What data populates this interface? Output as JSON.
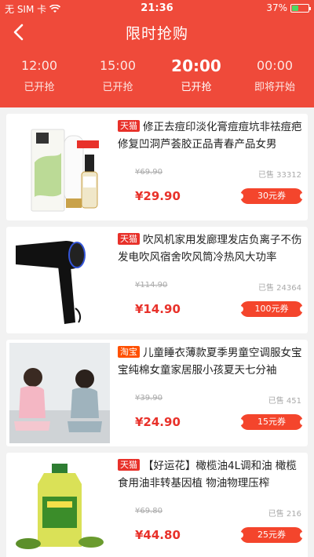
{
  "status": {
    "carrier": "无 SIM 卡",
    "time": "21:36",
    "battery": "37%"
  },
  "nav": {
    "title": "限时抢购"
  },
  "tabs": [
    {
      "time": "12:00",
      "status": "已开抢",
      "active": false
    },
    {
      "time": "15:00",
      "status": "已开抢",
      "active": false
    },
    {
      "time": "20:00",
      "status": "已开抢",
      "active": true
    },
    {
      "time": "00:00",
      "status": "即将开始",
      "active": false
    }
  ],
  "products": [
    {
      "tag": "天猫",
      "title": "修正去痘印淡化膏痘痘坑非祛痘疤修复凹洞芦荟胶正品青春产品女男",
      "orig_price": "¥69.90",
      "sold": "已售 33312",
      "price": "¥29.90",
      "coupon": "30元券"
    },
    {
      "tag": "天猫",
      "title": "吹风机家用发廊理发店负离子不伤发电吹风宿舍吹风筒冷热风大功率",
      "orig_price": "¥114.90",
      "sold": "已售 24364",
      "price": "¥14.90",
      "coupon": "100元券"
    },
    {
      "tag": "淘宝",
      "title": "儿童睡衣薄款夏季男童空调服女宝宝纯棉女童家居服小孩夏天七分袖",
      "orig_price": "¥39.90",
      "sold": "已售 451",
      "price": "¥24.90",
      "coupon": "15元券"
    },
    {
      "tag": "天猫",
      "title": "【好运花】橄榄油4L调和油 橄榄食用油非转基因植 物油物理压榨",
      "orig_price": "¥69.80",
      "sold": "已售 216",
      "price": "¥44.80",
      "coupon": "25元券"
    }
  ],
  "colors": {
    "header": "#ef4a3a",
    "accent": "#e8312a",
    "tag": "#e8312a",
    "background": "#f2f2f2"
  }
}
